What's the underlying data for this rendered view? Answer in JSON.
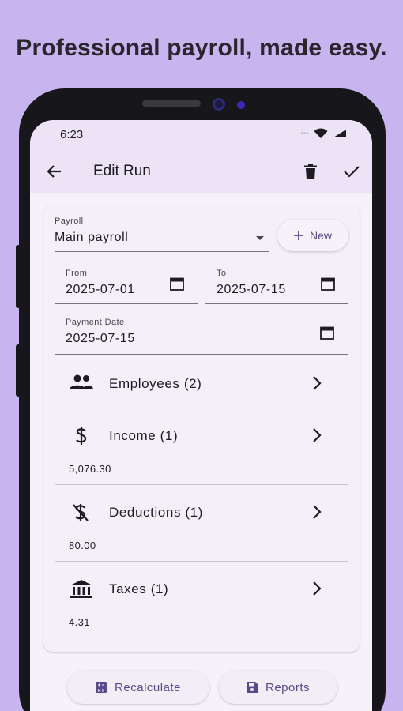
{
  "promo": {
    "headline": "Professional payroll, made easy."
  },
  "status": {
    "time": "6:23"
  },
  "appbar": {
    "title": "Edit Run",
    "back_icon": "arrow-back-icon",
    "delete_icon": "trash-icon",
    "save_icon": "check-icon"
  },
  "form": {
    "payroll_label": "Payroll",
    "payroll_value": "Main payroll",
    "new_button": "New",
    "from_label": "From",
    "from_value": "2025-07-01",
    "to_label": "To",
    "to_value": "2025-07-15",
    "payment_label": "Payment Date",
    "payment_value": "2025-07-15"
  },
  "sections": [
    {
      "title": "Employees (2)",
      "icon": "people-icon",
      "value": ""
    },
    {
      "title": "Income (1)",
      "icon": "dollar-icon",
      "value": "5,076.30"
    },
    {
      "title": "Deductions (1)",
      "icon": "money-off-icon",
      "value": "80.00"
    },
    {
      "title": "Taxes (1)",
      "icon": "bank-icon",
      "value": "4.31"
    }
  ],
  "actions": {
    "recalculate": "Recalculate",
    "reports": "Reports"
  },
  "colors": {
    "background": "#c8b5f0",
    "accent": "#5a4a8a",
    "appbar": "#ece3f7"
  }
}
